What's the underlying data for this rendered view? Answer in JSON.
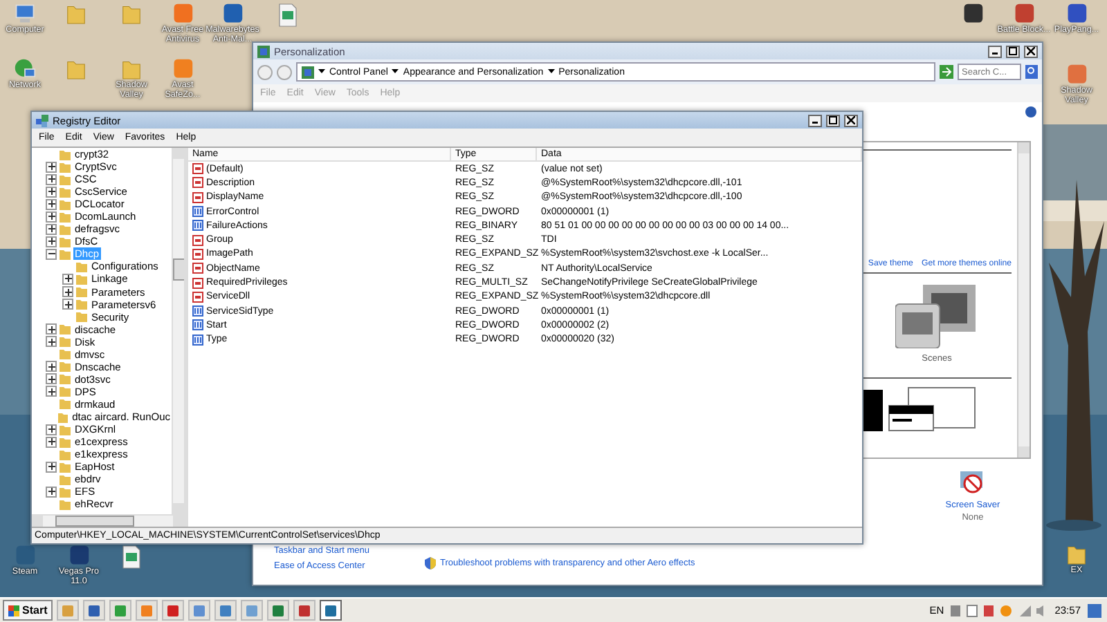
{
  "desktop_icons": [
    {
      "kind": "computer",
      "label": "Computer"
    },
    {
      "kind": "folder"
    },
    {
      "kind": "folder"
    },
    {
      "kind": "app",
      "color": "#f07020",
      "label": "Avast Free Antivirus"
    },
    {
      "kind": "app",
      "color": "#2060b0",
      "label": "Malwarebytes Anti-Mal..."
    },
    {
      "kind": "file"
    },
    {
      "kind": "network",
      "label": "Network"
    },
    {
      "kind": "folder"
    },
    {
      "kind": "folder",
      "label": "Shadow Valley"
    },
    {
      "kind": "app",
      "color": "#f08020",
      "label": "Avast SafeZo..."
    },
    {
      "kind": "app",
      "color": "#2a5a80",
      "label": "Steam"
    },
    {
      "kind": "app",
      "color": "#1a3a70",
      "label": "Vegas Pro 11.0"
    },
    {
      "kind": "file"
    },
    {
      "kind": "app",
      "color": "#303030"
    },
    {
      "kind": "app",
      "color": "#c04030",
      "label": "Battle Block..."
    },
    {
      "kind": "app",
      "color": "#3050c0",
      "label": "PlayPang..."
    },
    {
      "kind": "app",
      "color": "#e07040",
      "label": "Shadow Valley"
    },
    {
      "kind": "folder",
      "label": "EX"
    }
  ],
  "personalization": {
    "title": "Personalization",
    "breadcrumb": [
      "Control Panel",
      "Appearance and Personalization",
      "Personalization"
    ],
    "search": {
      "placeholder": "Search C..."
    },
    "menu": [
      "File",
      "Edit",
      "View",
      "Tools",
      "Help"
    ],
    "theme_links": [
      "Save theme",
      "Get more themes online"
    ],
    "theme": {
      "label": "Scenes"
    },
    "screen_saver": {
      "label": "Screen Saver",
      "value": "None"
    },
    "see_also": [
      "Taskbar and Start menu",
      "Ease of Access Center"
    ],
    "troubleshoot": "Troubleshoot problems with transparency and other Aero effects"
  },
  "registry_editor": {
    "title": "Registry Editor",
    "menu": [
      "File",
      "Edit",
      "View",
      "Favorites",
      "Help"
    ],
    "tree": [
      {
        "label": "crypt32",
        "selected": false
      },
      {
        "label": "CryptSvc",
        "expanded": false,
        "selected": false
      },
      {
        "label": "CSC",
        "expanded": false,
        "selected": false
      },
      {
        "label": "CscService",
        "expanded": false,
        "selected": false
      },
      {
        "label": "DCLocator",
        "expanded": false,
        "selected": false
      },
      {
        "label": "DcomLaunch",
        "expanded": false,
        "selected": false
      },
      {
        "label": "defragsvc",
        "expanded": false,
        "selected": false
      },
      {
        "label": "DfsC",
        "expanded": false,
        "selected": false
      },
      {
        "label": "Dhcp",
        "expanded": true,
        "selected": true,
        "children": [
          {
            "label": "Configurations",
            "selected": false
          },
          {
            "label": "Linkage",
            "expanded": false,
            "selected": false
          },
          {
            "label": "Parameters",
            "expanded": false,
            "selected": false
          },
          {
            "label": "Parametersv6",
            "expanded": false,
            "selected": false
          },
          {
            "label": "Security",
            "selected": false
          }
        ]
      },
      {
        "label": "discache",
        "expanded": false,
        "selected": false
      },
      {
        "label": "Disk",
        "expanded": false,
        "selected": false
      },
      {
        "label": "dmvsc",
        "selected": false
      },
      {
        "label": "Dnscache",
        "expanded": false,
        "selected": false
      },
      {
        "label": "dot3svc",
        "expanded": false,
        "selected": false
      },
      {
        "label": "DPS",
        "expanded": false,
        "selected": false
      },
      {
        "label": "drmkaud",
        "selected": false
      },
      {
        "label": "dtac aircard. RunOuc",
        "selected": false
      },
      {
        "label": "DXGKrnl",
        "expanded": false,
        "selected": false
      },
      {
        "label": "e1cexpress",
        "expanded": false,
        "selected": false
      },
      {
        "label": "e1kexpress",
        "selected": false
      },
      {
        "label": "EapHost",
        "expanded": false,
        "selected": false
      },
      {
        "label": "ebdrv",
        "selected": false
      },
      {
        "label": "EFS",
        "expanded": false,
        "selected": false
      },
      {
        "label": "ehRecvr",
        "selected": false
      }
    ],
    "columns": [
      "Name",
      "Type",
      "Data"
    ],
    "values": [
      {
        "kind": "string",
        "name": "(Default)",
        "type": "REG_SZ",
        "data": "(value not set)"
      },
      {
        "kind": "string",
        "name": "Description",
        "type": "REG_SZ",
        "data": "@%SystemRoot%\\system32\\dhcpcore.dll,-101"
      },
      {
        "kind": "string",
        "name": "DisplayName",
        "type": "REG_SZ",
        "data": "@%SystemRoot%\\system32\\dhcpcore.dll,-100"
      },
      {
        "kind": "binary",
        "name": "ErrorControl",
        "type": "REG_DWORD",
        "data": "0x00000001 (1)"
      },
      {
        "kind": "binary",
        "name": "FailureActions",
        "type": "REG_BINARY",
        "data": "80 51 01 00 00 00 00 00 00 00 00 00 03 00 00 00 14 00..."
      },
      {
        "kind": "string",
        "name": "Group",
        "type": "REG_SZ",
        "data": "TDI"
      },
      {
        "kind": "string",
        "name": "ImagePath",
        "type": "REG_EXPAND_SZ",
        "data": "%SystemRoot%\\system32\\svchost.exe -k LocalSer..."
      },
      {
        "kind": "string",
        "name": "ObjectName",
        "type": "REG_SZ",
        "data": "NT Authority\\LocalService"
      },
      {
        "kind": "string",
        "name": "RequiredPrivileges",
        "type": "REG_MULTI_SZ",
        "data": "SeChangeNotifyPrivilege SeCreateGlobalPrivilege"
      },
      {
        "kind": "string",
        "name": "ServiceDll",
        "type": "REG_EXPAND_SZ",
        "data": "%SystemRoot%\\system32\\dhcpcore.dll"
      },
      {
        "kind": "binary",
        "name": "ServiceSidType",
        "type": "REG_DWORD",
        "data": "0x00000001 (1)"
      },
      {
        "kind": "binary",
        "name": "Start",
        "type": "REG_DWORD",
        "data": "0x00000002 (2)"
      },
      {
        "kind": "binary",
        "name": "Type",
        "type": "REG_DWORD",
        "data": "0x00000020 (32)"
      }
    ],
    "status_bar": "Computer\\HKEY_LOCAL_MACHINE\\SYSTEM\\CurrentControlSet\\services\\Dhcp"
  },
  "taskbar": {
    "start": "Start",
    "apps": [
      {
        "color": "#d8a040",
        "selected": false
      },
      {
        "color": "#3060b0",
        "selected": false
      },
      {
        "color": "#30a040",
        "selected": false
      },
      {
        "color": "#f08020",
        "selected": false
      },
      {
        "color": "#d02020",
        "selected": false
      },
      {
        "color": "#6090d0",
        "selected": false
      },
      {
        "color": "#4080c0",
        "selected": false
      },
      {
        "color": "#70a0d0",
        "selected": false
      },
      {
        "color": "#208040",
        "selected": false
      },
      {
        "color": "#c03030",
        "selected": false
      },
      {
        "color": "#2070a0",
        "selected": true
      }
    ],
    "language": "EN",
    "clock": "23:57"
  }
}
